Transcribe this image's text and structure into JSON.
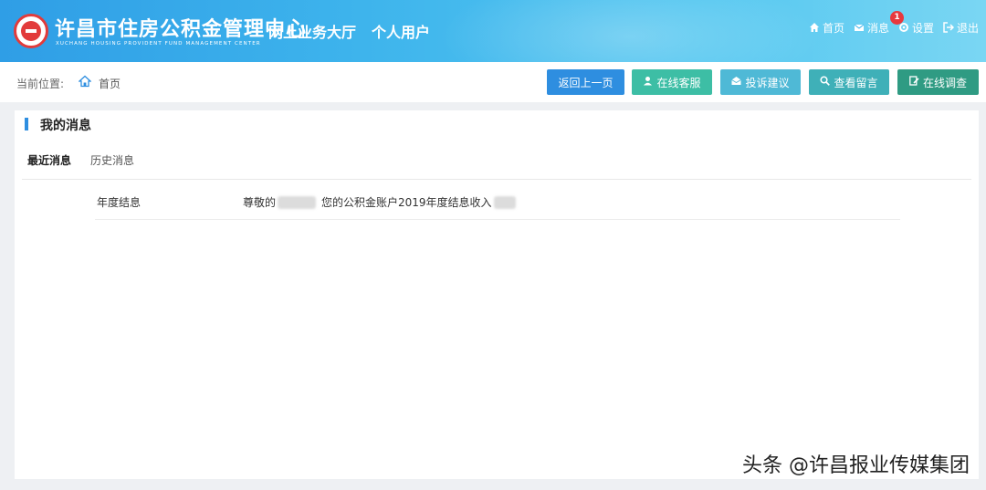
{
  "header": {
    "brand_cn": "许昌市住房公积金管理中心",
    "brand_en": "XUCHANG HOUSING PROVIDENT FUND MANAGEMENT CENTER",
    "hall_title": "网上业务大厅",
    "user_title": "个人用户",
    "nav": {
      "home": "首页",
      "messages": "消息",
      "messages_badge": "1",
      "settings": "设置",
      "logout": "退出"
    }
  },
  "toolbar": {
    "crumb_label": "当前位置:",
    "crumb_home": "首页",
    "buttons": {
      "back": "返回上一页",
      "service": "在线客服",
      "complaint": "投诉建议",
      "message": "查看留言",
      "survey": "在线调查"
    }
  },
  "panel": {
    "title": "我的消息",
    "tabs": {
      "recent": "最近消息",
      "history": "历史消息"
    },
    "messages": [
      {
        "type": "年度结息",
        "content_prefix": "尊敬的",
        "content_suffix": "您的公积金账户2019年度结息收入"
      }
    ]
  },
  "watermark": "头条 @许昌报业传媒集团",
  "colors": {
    "header_start": "#2f9ee6",
    "header_end": "#7ad6f3",
    "btn_back": "#2e8ee0",
    "btn_service": "#3dbea5",
    "btn_complaint": "#4fb9d6",
    "btn_message": "#3fb0b8",
    "btn_survey": "#2f9b83",
    "badge": "#e8383d",
    "logo_red": "#e23b3b"
  }
}
